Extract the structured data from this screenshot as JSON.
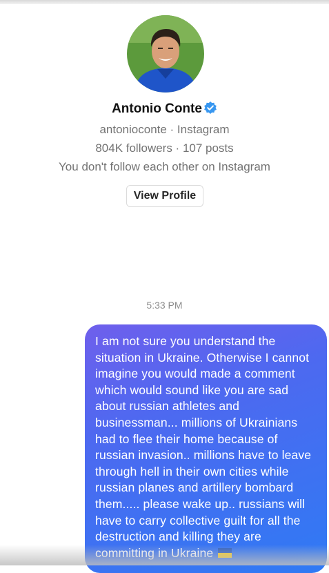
{
  "profile": {
    "name": "Antonio Conte",
    "handle_line": "antonioconte · Instagram",
    "stats_line": "804K followers · 107 posts",
    "follow_line": "You don't follow each other on Instagram",
    "view_profile_label": "View Profile",
    "verified": true,
    "verified_color": "#3897f0"
  },
  "conversation": {
    "timestamp": "5:33 PM",
    "messages": [
      {
        "sender": "me",
        "text": "I am not sure you understand the situation in Ukraine. Otherwise I cannot imagine you would made a comment which would sound like you are sad about russian athletes and businessman... millions of Ukrainians had to flee their home because of russian invasion.. millions have to leave through hell in their own cities while russian planes and artillery bombard them..... please wake up.. russians will have to carry collective guilt for all the destruction and killing they are committing in Ukraine",
        "trailing_emoji": "ukraine-flag-icon"
      }
    ]
  },
  "colors": {
    "bubble_gradient_start": "#6f5fec",
    "bubble_gradient_end": "#2f7af4",
    "secondary_text": "#737373"
  }
}
